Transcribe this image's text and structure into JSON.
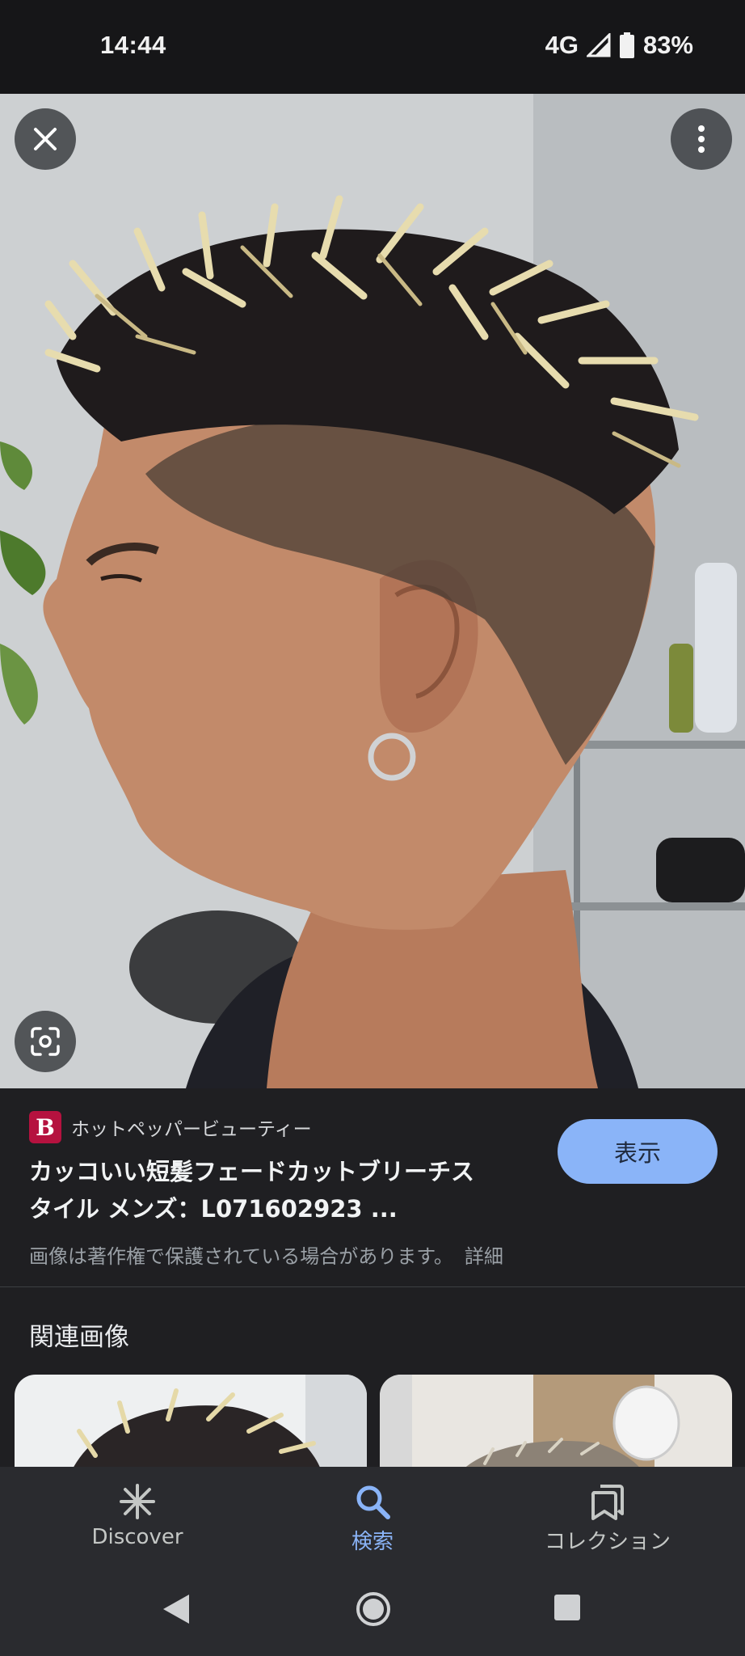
{
  "status_bar": {
    "time": "14:44",
    "network": "4G",
    "battery": "83%"
  },
  "image_viewer": {
    "close_icon": "close-icon",
    "more_icon": "more-vert-icon",
    "lens_icon": "lens-icon"
  },
  "result": {
    "source_logo_letter": "B",
    "source_name": "ホットペッパービューティー",
    "title_line1": "カッコいい短髪フェードカットブリーチス",
    "title_line2": "タイル メンズ：L071602923 ...",
    "view_button": "表示",
    "copyright_note": "画像は著作権で保護されている場合があります。",
    "details_link": "詳細"
  },
  "related": {
    "title": "関連画像"
  },
  "bottom_nav": {
    "items": [
      {
        "label": "Discover",
        "icon": "asterisk-icon",
        "active": false
      },
      {
        "label": "検索",
        "icon": "search-icon",
        "active": true
      },
      {
        "label": "コレクション",
        "icon": "collections-icon",
        "active": false
      }
    ]
  },
  "colors": {
    "accent": "#8ab4f8",
    "background": "#1f1f22",
    "nav_background": "#2a2b2f"
  }
}
